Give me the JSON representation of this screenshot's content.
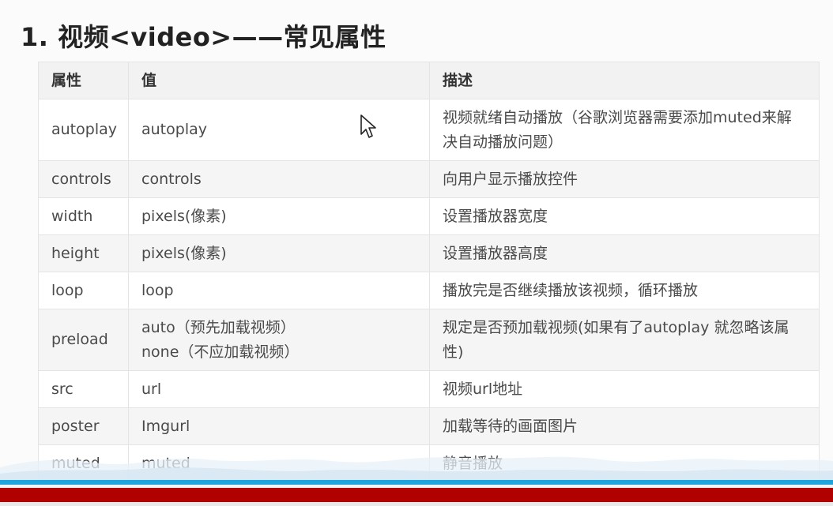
{
  "heading": {
    "title": "1. 视频<video>——常见属性"
  },
  "table": {
    "headers": [
      "属性",
      "值",
      "描述"
    ],
    "rows": [
      {
        "attr": "autoplay",
        "value": [
          "autoplay"
        ],
        "desc": [
          "视频就绪自动播放（谷歌浏览器需要添加muted来解",
          "决自动播放问题）"
        ]
      },
      {
        "attr": "controls",
        "value": [
          "controls"
        ],
        "desc": [
          "向用户显示播放控件"
        ]
      },
      {
        "attr": "width",
        "value": [
          "pixels(像素)"
        ],
        "desc": [
          "设置播放器宽度"
        ]
      },
      {
        "attr": "height",
        "value": [
          "pixels(像素)"
        ],
        "desc": [
          "设置播放器高度"
        ]
      },
      {
        "attr": "loop",
        "value": [
          "loop"
        ],
        "desc": [
          "播放完是否继续播放该视频，循环播放"
        ]
      },
      {
        "attr": "preload",
        "value": [
          "auto（预先加载视频）",
          "none（不应加载视频）"
        ],
        "desc": [
          "规定是否预加载视频(如果有了autoplay  就忽略该属",
          "性)"
        ]
      },
      {
        "attr": "src",
        "value": [
          "url"
        ],
        "desc": [
          "视频url地址"
        ]
      },
      {
        "attr": "poster",
        "value": [
          "Imgurl"
        ],
        "desc": [
          "加载等待的画面图片"
        ]
      },
      {
        "attr": "muted",
        "value": [
          "muted"
        ],
        "desc": [
          "静音播放"
        ]
      }
    ]
  },
  "colors": {
    "bottom_red": "#b00000",
    "bottom_blue": "#1fa3dd"
  }
}
